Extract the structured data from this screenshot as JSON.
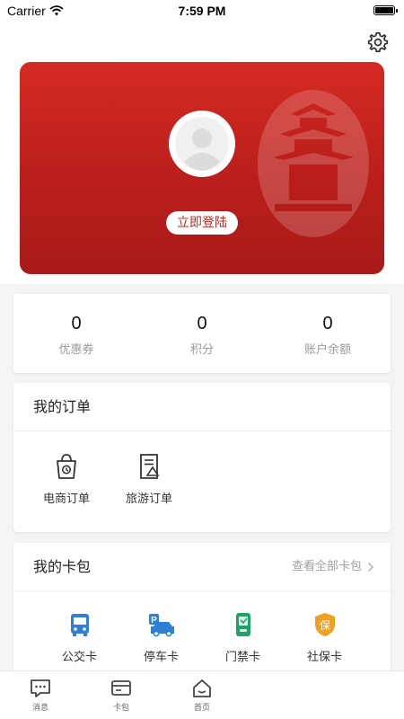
{
  "status_bar": {
    "carrier": "Carrier",
    "time": "7:59 PM"
  },
  "profile": {
    "login_label": "立即登陆",
    "card_color": "#c8261f"
  },
  "stats": [
    {
      "value": "0",
      "label": "优惠券"
    },
    {
      "value": "0",
      "label": "积分"
    },
    {
      "value": "0",
      "label": "账户余额"
    }
  ],
  "orders": {
    "title": "我的订单",
    "items": [
      {
        "label": "电商订单",
        "icon": "shopping-bag-icon"
      },
      {
        "label": "旅游订单",
        "icon": "travel-doc-icon"
      }
    ]
  },
  "wallet": {
    "title": "我的卡包",
    "view_all": "查看全部卡包",
    "items": [
      {
        "label": "公交卡",
        "icon": "bus-icon"
      },
      {
        "label": "停车卡",
        "icon": "parking-car-icon"
      },
      {
        "label": "门禁卡",
        "icon": "access-card-icon"
      },
      {
        "label": "社保卡",
        "icon": "social-security-icon",
        "glyph": "保"
      }
    ]
  },
  "tab_bar": [
    {
      "label": "消息",
      "icon": "message-icon"
    },
    {
      "label": "卡包",
      "icon": "card-wallet-icon"
    },
    {
      "label": "首页",
      "icon": "home-icon"
    }
  ],
  "colors": {
    "brand_red": "#c8261f",
    "icon_blue": "#2f7fd6",
    "icon_gold": "#f0a020"
  }
}
